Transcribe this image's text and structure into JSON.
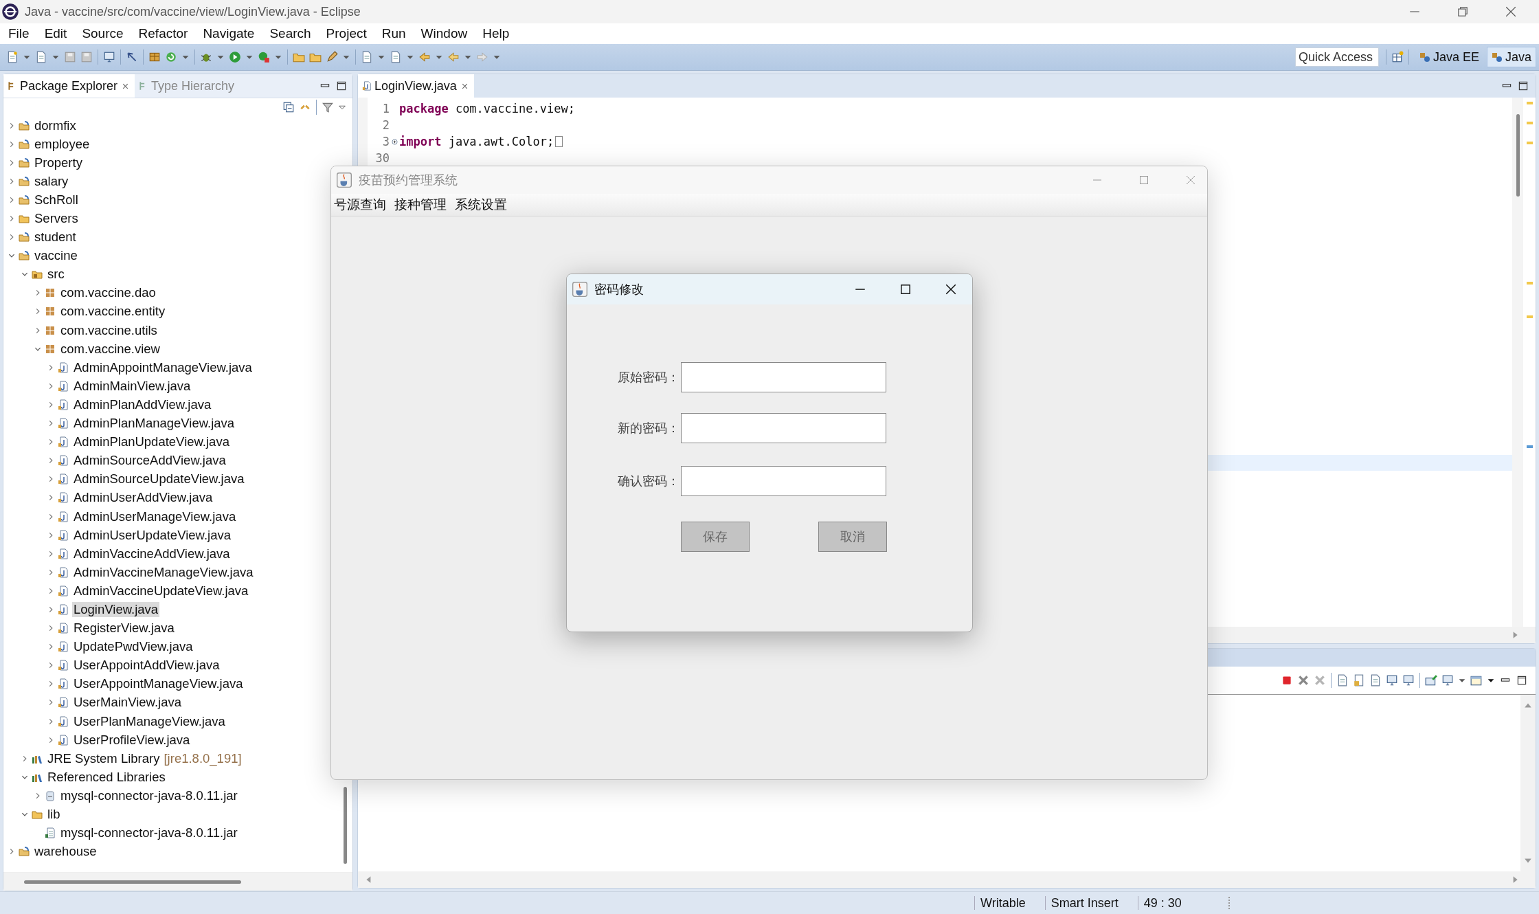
{
  "window": {
    "title": "Java - vaccine/src/com/vaccine/view/LoginView.java - Eclipse"
  },
  "menu": [
    "File",
    "Edit",
    "Source",
    "Refactor",
    "Navigate",
    "Search",
    "Project",
    "Run",
    "Window",
    "Help"
  ],
  "toolbar": {
    "quick_access": {
      "placeholder": "Quick Access"
    },
    "perspectives": [
      {
        "label": "Java EE",
        "selected": false
      },
      {
        "label": "Java",
        "selected": true
      }
    ]
  },
  "package_explorer": {
    "tabs": [
      {
        "label": "Package Explorer",
        "selected": true
      },
      {
        "label": "Type Hierarchy",
        "selected": false
      }
    ],
    "tree": [
      {
        "label": "dormfix",
        "kind": "project",
        "expanded": false,
        "selected": false
      },
      {
        "label": "employee",
        "kind": "project",
        "expanded": false,
        "selected": false
      },
      {
        "label": "Property",
        "kind": "project",
        "expanded": false,
        "selected": false
      },
      {
        "label": "salary",
        "kind": "project",
        "expanded": false,
        "selected": false
      },
      {
        "label": "SchRoll",
        "kind": "project",
        "expanded": false,
        "selected": false
      },
      {
        "label": "Servers",
        "kind": "folder",
        "expanded": false,
        "selected": false
      },
      {
        "label": "student",
        "kind": "project",
        "expanded": false,
        "selected": false
      },
      {
        "label": "vaccine",
        "kind": "project",
        "expanded": true,
        "selected": false,
        "children": [
          {
            "label": "src",
            "kind": "source",
            "expanded": true,
            "selected": false,
            "children": [
              {
                "label": "com.vaccine.dao",
                "kind": "package",
                "expanded": false,
                "selected": false
              },
              {
                "label": "com.vaccine.entity",
                "kind": "package",
                "expanded": false,
                "selected": false
              },
              {
                "label": "com.vaccine.utils",
                "kind": "package",
                "expanded": false,
                "selected": false
              },
              {
                "label": "com.vaccine.view",
                "kind": "package",
                "expanded": true,
                "selected": false,
                "children": [
                  {
                    "label": "AdminAppointManageView.java",
                    "kind": "java",
                    "expanded": false,
                    "selected": false
                  },
                  {
                    "label": "AdminMainView.java",
                    "kind": "java",
                    "expanded": false,
                    "selected": false
                  },
                  {
                    "label": "AdminPlanAddView.java",
                    "kind": "java",
                    "expanded": false,
                    "selected": false
                  },
                  {
                    "label": "AdminPlanManageView.java",
                    "kind": "java",
                    "expanded": false,
                    "selected": false
                  },
                  {
                    "label": "AdminPlanUpdateView.java",
                    "kind": "java",
                    "expanded": false,
                    "selected": false
                  },
                  {
                    "label": "AdminSourceAddView.java",
                    "kind": "java",
                    "expanded": false,
                    "selected": false
                  },
                  {
                    "label": "AdminSourceUpdateView.java",
                    "kind": "java",
                    "expanded": false,
                    "selected": false
                  },
                  {
                    "label": "AdminUserAddView.java",
                    "kind": "java",
                    "expanded": false,
                    "selected": false
                  },
                  {
                    "label": "AdminUserManageView.java",
                    "kind": "java",
                    "expanded": false,
                    "selected": false
                  },
                  {
                    "label": "AdminUserUpdateView.java",
                    "kind": "java",
                    "expanded": false,
                    "selected": false
                  },
                  {
                    "label": "AdminVaccineAddView.java",
                    "kind": "java",
                    "expanded": false,
                    "selected": false
                  },
                  {
                    "label": "AdminVaccineManageView.java",
                    "kind": "java",
                    "expanded": false,
                    "selected": false
                  },
                  {
                    "label": "AdminVaccineUpdateView.java",
                    "kind": "java",
                    "expanded": false,
                    "selected": false
                  },
                  {
                    "label": "LoginView.java",
                    "kind": "java",
                    "expanded": false,
                    "selected": true
                  },
                  {
                    "label": "RegisterView.java",
                    "kind": "java",
                    "expanded": false,
                    "selected": false
                  },
                  {
                    "label": "UpdatePwdView.java",
                    "kind": "java",
                    "expanded": false,
                    "selected": false
                  },
                  {
                    "label": "UserAppointAddView.java",
                    "kind": "java",
                    "expanded": false,
                    "selected": false
                  },
                  {
                    "label": "UserAppointManageView.java",
                    "kind": "java",
                    "expanded": false,
                    "selected": false
                  },
                  {
                    "label": "UserMainView.java",
                    "kind": "java",
                    "expanded": false,
                    "selected": false
                  },
                  {
                    "label": "UserPlanManageView.java",
                    "kind": "java",
                    "expanded": false,
                    "selected": false
                  },
                  {
                    "label": "UserProfileView.java",
                    "kind": "java",
                    "expanded": false,
                    "selected": false
                  }
                ]
              }
            ]
          },
          {
            "label": "JRE System Library",
            "decoration": "[jre1.8.0_191]",
            "kind": "library",
            "expanded": false,
            "selected": false
          },
          {
            "label": "Referenced Libraries",
            "kind": "library",
            "expanded": true,
            "selected": false,
            "children": [
              {
                "label": "mysql-connector-java-8.0.11.jar",
                "kind": "jar",
                "expanded": false,
                "selected": false
              }
            ]
          },
          {
            "label": "lib",
            "kind": "folder",
            "expanded": true,
            "selected": false,
            "children": [
              {
                "label": "mysql-connector-java-8.0.11.jar",
                "kind": "file",
                "selected": false
              }
            ]
          }
        ]
      },
      {
        "label": "warehouse",
        "kind": "project",
        "expanded": false,
        "selected": false
      }
    ]
  },
  "editor": {
    "tabs": [
      {
        "label": "LoginView.java",
        "selected": true
      }
    ],
    "lines": [
      {
        "number": "1",
        "keyword": "package",
        "code": " com.vaccine.view;"
      },
      {
        "number": "2"
      },
      {
        "number": "3",
        "keyword": "import",
        "code": " java.awt.Color;",
        "folded": true
      },
      {
        "number": "30"
      }
    ]
  },
  "app_window": {
    "title": "疫苗预约管理系统",
    "menu": [
      "号源查询",
      "接种管理",
      "系统设置"
    ]
  },
  "dialog": {
    "title": "密码修改",
    "fields": [
      {
        "label": "原始密码："
      },
      {
        "label": "新的密码："
      },
      {
        "label": "确认密码："
      }
    ],
    "buttons": [
      "保存",
      "取消"
    ]
  },
  "status_bar": [
    "Writable",
    "Smart Insert",
    "49 : 30"
  ]
}
